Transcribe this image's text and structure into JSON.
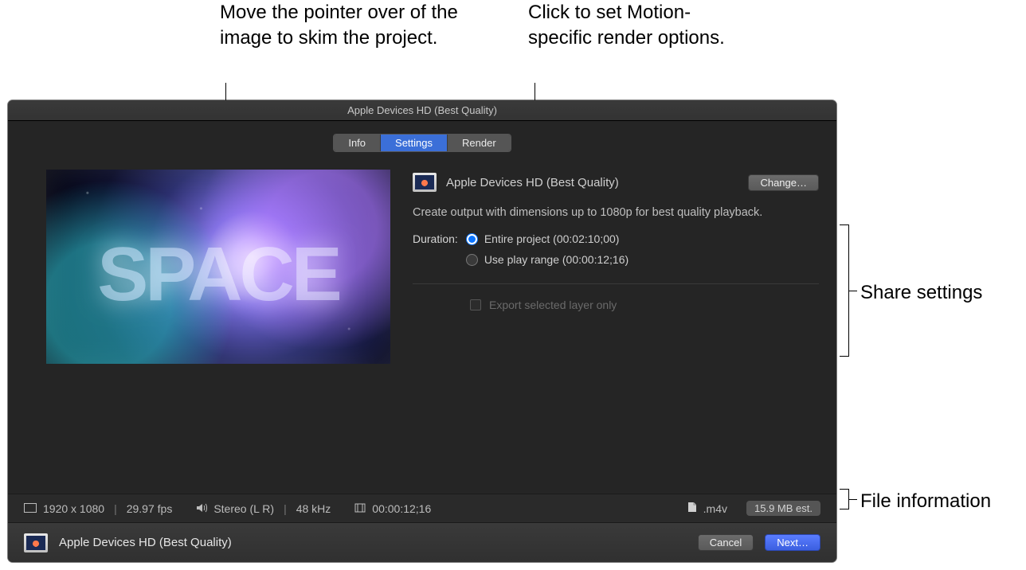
{
  "callouts": {
    "skim": "Move the pointer over of the image to skim the project.",
    "render": "Click to set Motion-specific render options.",
    "share_settings": "Share settings",
    "file_info": "File information"
  },
  "window": {
    "title": "Apple Devices HD (Best Quality)"
  },
  "tabs": {
    "info": "Info",
    "settings": "Settings",
    "render": "Render",
    "selected": "Settings"
  },
  "preview": {
    "text": "SPACE"
  },
  "preset": {
    "title": "Apple Devices HD (Best Quality)",
    "change": "Change…"
  },
  "description": "Create output with dimensions up to 1080p for best quality playback.",
  "duration": {
    "label": "Duration:",
    "entire": "Entire project (00:02:10;00)",
    "playrange": "Use play range (00:00:12;16)",
    "selected": "entire"
  },
  "export_layer": "Export selected layer only",
  "status": {
    "resolution": "1920 x 1080",
    "fps": "29.97 fps",
    "audio": "Stereo (L R)",
    "samplerate": "48 kHz",
    "duration": "00:00:12;16",
    "extension": ".m4v",
    "size_est": "15.9 MB est."
  },
  "footer": {
    "title": "Apple Devices HD (Best Quality)",
    "cancel": "Cancel",
    "next": "Next…"
  }
}
